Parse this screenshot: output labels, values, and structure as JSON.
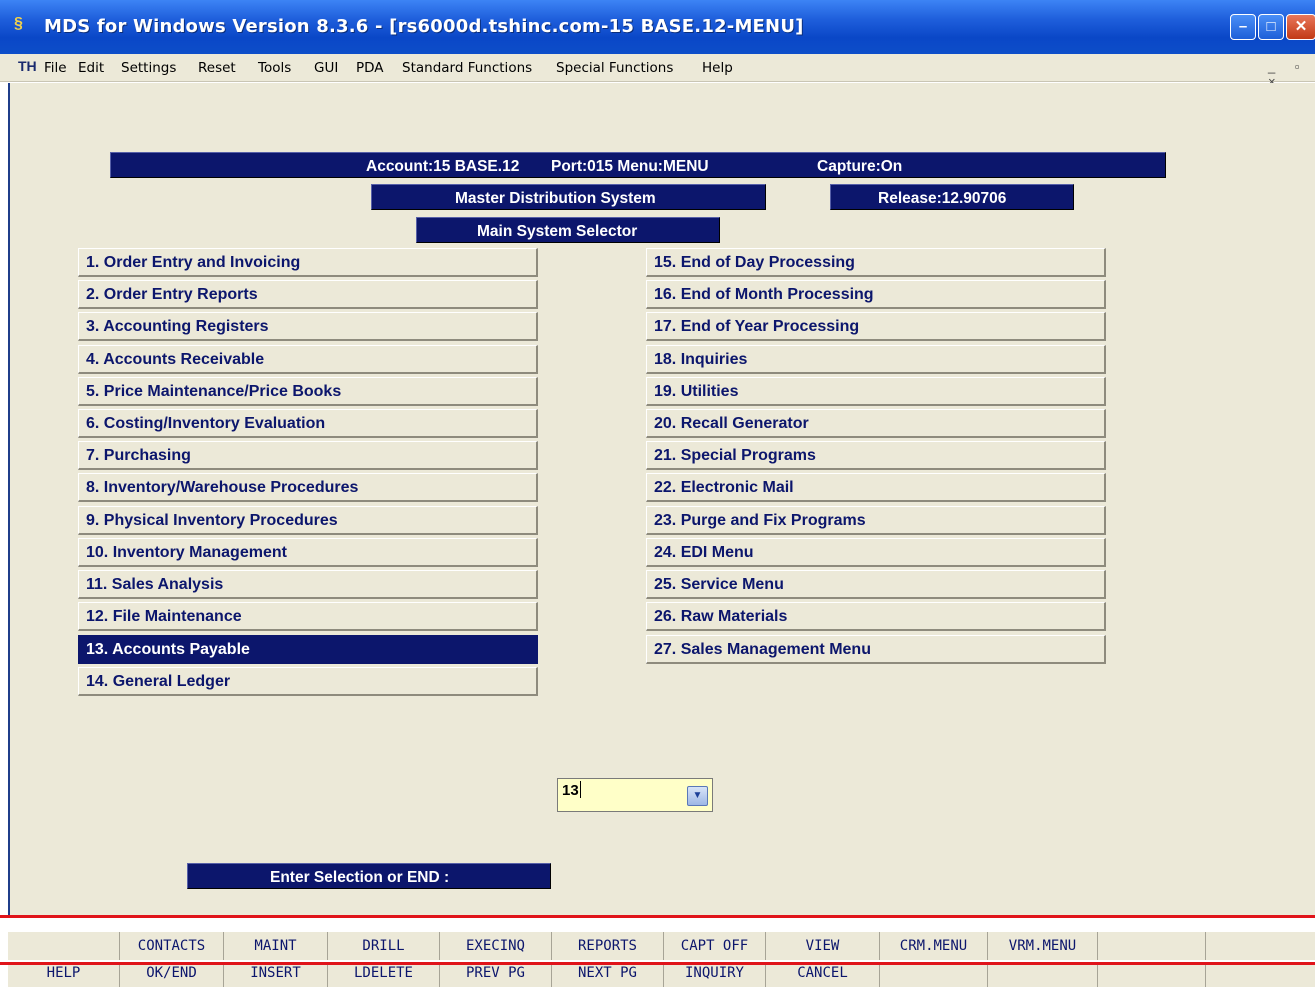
{
  "window": {
    "title": "MDS for Windows Version 8.3.6 - [rs6000d.tshinc.com-15 BASE.12-MENU]",
    "min_glyph": "–",
    "max_glyph": "□",
    "close_glyph": "✕"
  },
  "menubar": {
    "items": [
      "File",
      "Edit",
      "Settings",
      "Reset",
      "Tools",
      "GUI",
      "PDA",
      "Standard Functions",
      "Special Functions",
      "Help"
    ],
    "mdi_controls": "_ ▫ ×"
  },
  "header": {
    "account": "Account:15 BASE.12",
    "port_menu": "Port:015 Menu:MENU",
    "capture": "Capture:On",
    "system_name": "Master Distribution System",
    "release": "Release:12.90706",
    "selector_title": "Main System Selector"
  },
  "menu_left": [
    "1. Order Entry and Invoicing",
    "2. Order Entry Reports",
    "3. Accounting Registers",
    "4. Accounts Receivable",
    "5. Price Maintenance/Price Books",
    "6. Costing/Inventory Evaluation",
    "7. Purchasing",
    "8. Inventory/Warehouse Procedures",
    "9. Physical Inventory Procedures",
    "10. Inventory Management",
    "11. Sales Analysis",
    "12. File Maintenance",
    "13. Accounts Payable",
    "14. General Ledger"
  ],
  "menu_right": [
    "15. End of Day Processing",
    "16. End of Month Processing",
    "17. End of Year Processing",
    "18. Inquiries",
    "19. Utilities",
    "20. Recall Generator",
    "21. Special Programs",
    "22. Electronic Mail",
    "23. Purge and Fix Programs",
    "24. EDI Menu",
    "25. Service Menu",
    "26. Raw Materials",
    "27. Sales Management Menu"
  ],
  "selected_item": "13. Accounts Payable",
  "selection": {
    "label": "Enter Selection or END :",
    "value": "13"
  },
  "function_keys": {
    "row1": [
      "",
      "CONTACTS",
      "MAINT",
      "DRILL",
      "EXECINQ",
      "REPORTS",
      "CAPT OFF",
      "VIEW",
      "CRM.MENU",
      "VRM.MENU",
      "",
      ""
    ],
    "row2": [
      "HELP",
      "OK/END",
      "INSERT",
      "LDELETE",
      "PREV PG",
      "NEXT PG",
      "INQUIRY",
      "CANCEL",
      "",
      "",
      "",
      ""
    ]
  },
  "colors": {
    "navy": "#0c166c",
    "panel": "#ece9d8",
    "input_bg": "#ffffc8",
    "highlight_red": "#e0141a"
  }
}
